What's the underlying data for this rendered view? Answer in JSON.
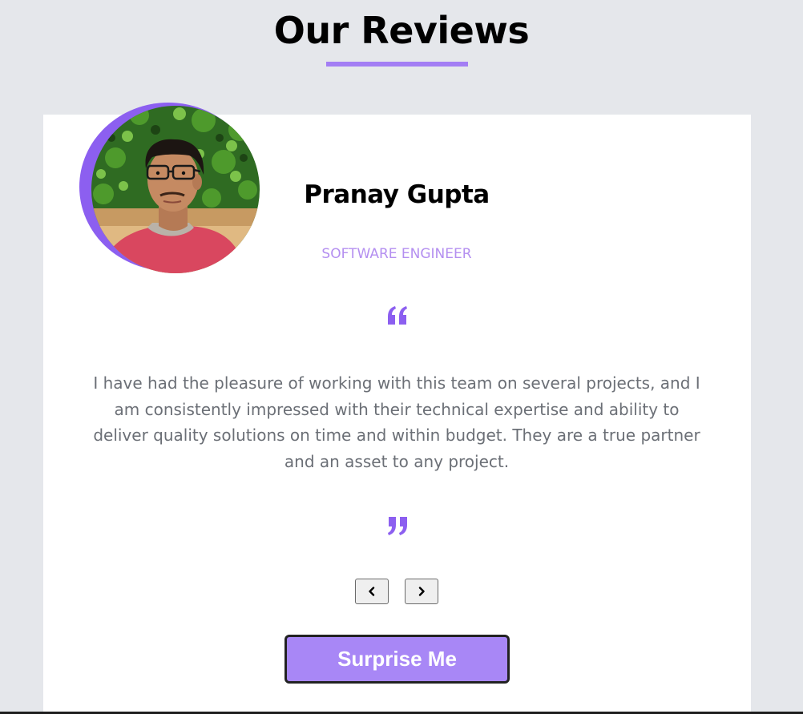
{
  "header": {
    "title": "Our Reviews"
  },
  "review": {
    "name": "Pranay Gupta",
    "job": "SOFTWARE ENGINEER",
    "text": "I have had the pleasure of working with this team on several projects, and I am consistently impressed with their technical expertise and ability to deliver quality solutions on time and within budget. They are a true partner and an asset to any project."
  },
  "controls": {
    "prev_icon": "chevron-left-icon",
    "next_icon": "chevron-right-icon",
    "surprise_label": "Surprise Me"
  },
  "colors": {
    "accent": "#a37ef4",
    "avatar_ring": "#8c5ff0",
    "job_title": "#b48ff0",
    "button_bg": "#a887f6",
    "page_bg": "#e5e7eb",
    "text_muted": "#6b6f76"
  }
}
